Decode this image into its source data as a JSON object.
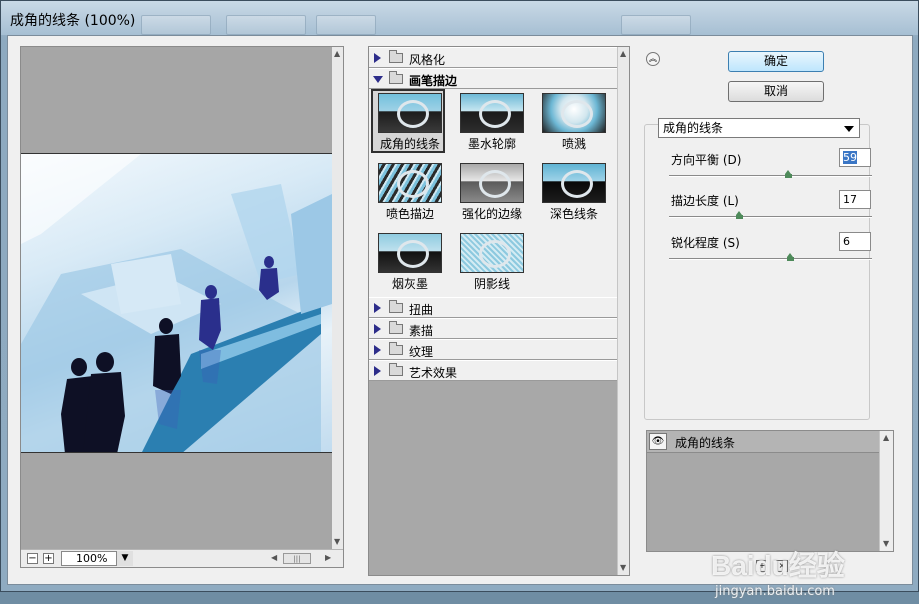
{
  "window": {
    "title": "成角的线条 (100%)"
  },
  "preview": {
    "zoom": "100%",
    "minus": "−",
    "plus": "+",
    "scroll_grip": "|||"
  },
  "categories": [
    {
      "label": "风格化",
      "expanded": false
    },
    {
      "label": "画笔描边",
      "expanded": true
    },
    {
      "label": "扭曲",
      "expanded": false
    },
    {
      "label": "素描",
      "expanded": false
    },
    {
      "label": "纹理",
      "expanded": false
    },
    {
      "label": "艺术效果",
      "expanded": false
    }
  ],
  "filters": [
    {
      "label": "成角的线条",
      "selected": true
    },
    {
      "label": "墨水轮廓",
      "selected": false
    },
    {
      "label": "喷溅",
      "selected": false
    },
    {
      "label": "喷色描边",
      "selected": false
    },
    {
      "label": "强化的边缘",
      "selected": false
    },
    {
      "label": "深色线条",
      "selected": false
    },
    {
      "label": "烟灰墨",
      "selected": false
    },
    {
      "label": "阴影线",
      "selected": false
    }
  ],
  "buttons": {
    "ok": "确定",
    "cancel": "取消",
    "collapse": "︽"
  },
  "filter_select": {
    "value": "成角的线条"
  },
  "params": [
    {
      "label": "方向平衡 (D)",
      "value": "59",
      "fraction": 0.59
    },
    {
      "label": "描边长度 (L)",
      "value": "17",
      "fraction": 0.34
    },
    {
      "label": "锐化程度 (S)",
      "value": "6",
      "fraction": 0.6
    }
  ],
  "layers": [
    {
      "name": "成角的线条",
      "visible": true
    }
  ],
  "watermark": {
    "main": "Baidu经验",
    "sub": "jingyan.baidu.com"
  }
}
